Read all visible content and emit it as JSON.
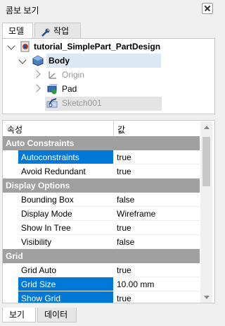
{
  "panel": {
    "title": "콤보 보기"
  },
  "tabs": [
    {
      "label": "모델",
      "active": true
    },
    {
      "label": "작업",
      "icon": "wrench-icon",
      "active": false
    }
  ],
  "tree": {
    "root": "tutorial_SimplePart_PartDesign",
    "body": "Body",
    "children": [
      {
        "label": "Origin",
        "icon": "axes-icon",
        "muted": true
      },
      {
        "label": "Pad",
        "icon": "pad-icon",
        "muted": false
      },
      {
        "label": "Sketch001",
        "icon": "sketch-icon",
        "muted": true,
        "selected": true
      }
    ]
  },
  "property_view": {
    "header": {
      "property": "속성",
      "value": "값"
    },
    "groups": [
      {
        "name": "Auto Constraints",
        "rows": [
          {
            "name": "Autoconstraints",
            "value": "true",
            "selected": true
          },
          {
            "name": "Avoid Redundant",
            "value": "true"
          }
        ]
      },
      {
        "name": "Display Options",
        "rows": [
          {
            "name": "Bounding Box",
            "value": "false"
          },
          {
            "name": "Display Mode",
            "value": "Wireframe"
          },
          {
            "name": "Show In Tree",
            "value": "true"
          },
          {
            "name": "Visibility",
            "value": "false"
          }
        ]
      },
      {
        "name": "Grid",
        "rows": [
          {
            "name": "Grid Auto",
            "value": "true"
          },
          {
            "name": "Grid Size",
            "value": "10.00 mm",
            "selected": true
          },
          {
            "name": "Show Grid",
            "value": "true",
            "selected": true
          }
        ]
      }
    ]
  },
  "bottom_tabs": [
    {
      "label": "보기",
      "active": true
    },
    {
      "label": "데이터",
      "active": false
    }
  ],
  "colors": {
    "selection": "#0078d7",
    "group_header": "#a0a0a0"
  }
}
